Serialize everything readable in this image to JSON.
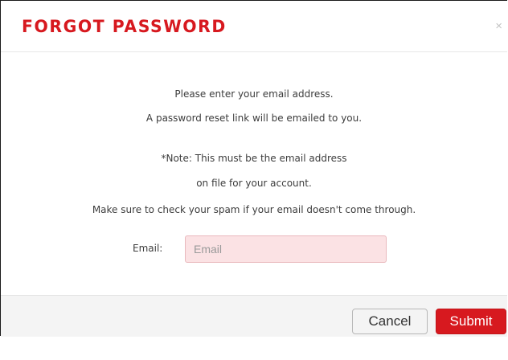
{
  "modal": {
    "title": "FORGOT PASSWORD",
    "close_icon": "×"
  },
  "body": {
    "lines": [
      "Please enter your email address.",
      "A password reset link will be emailed to you.",
      "*Note: This must be the email address",
      "on file for your account.",
      "Make sure to check your spam if your email doesn't come through."
    ],
    "email_label": "Email:",
    "email_placeholder": "Email",
    "email_value": ""
  },
  "footer": {
    "cancel_label": "Cancel",
    "submit_label": "Submit"
  },
  "colors": {
    "accent": "#d7191f",
    "input_background": "#fbe2e4",
    "footer_background": "#f4f4f4"
  },
  "icons": {
    "close": "close-icon"
  }
}
